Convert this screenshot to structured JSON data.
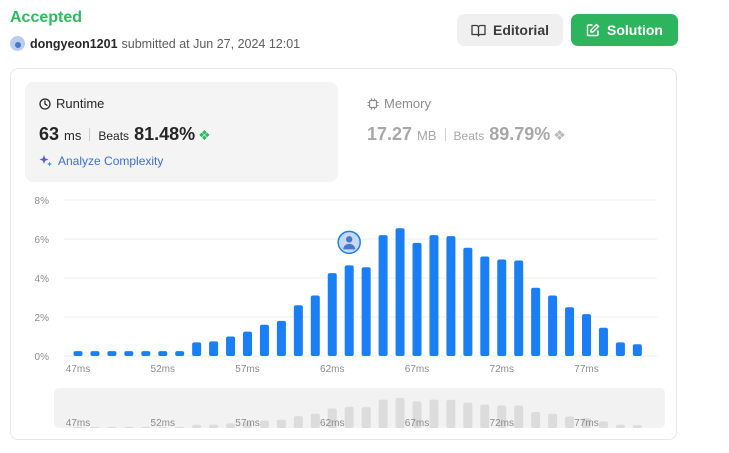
{
  "header": {
    "status": "Accepted",
    "username": "dongyeon1201",
    "submitted_text": "submitted at Jun 27, 2024 12:01"
  },
  "buttons": {
    "editorial": "Editorial",
    "solution": "Solution"
  },
  "runtime": {
    "label": "Runtime",
    "value": "63",
    "unit": "ms",
    "beats_label": "Beats",
    "beats_pct": "81.48%",
    "analyze_label": "Analyze Complexity"
  },
  "memory": {
    "label": "Memory",
    "value": "17.27",
    "unit": "MB",
    "beats_label": "Beats",
    "beats_pct": "89.79%"
  },
  "colors": {
    "accepted": "#2cbb5d",
    "bar": "#1a7ef5",
    "solution_button": "#2db55d",
    "overview_bar": "#dcdcdc"
  },
  "chart_data": {
    "type": "bar",
    "ylabel": "",
    "xlabel": "",
    "ylim": [
      0,
      8
    ],
    "yticks": [
      "0%",
      "2%",
      "4%",
      "6%",
      "8%"
    ],
    "xtick_labels": [
      "47ms",
      "52ms",
      "57ms",
      "62ms",
      "67ms",
      "72ms",
      "77ms"
    ],
    "x": [
      47,
      48,
      49,
      50,
      51,
      52,
      53,
      54,
      55,
      56,
      57,
      58,
      59,
      60,
      61,
      62,
      63,
      64,
      65,
      66,
      67,
      68,
      69,
      70,
      71,
      72,
      73,
      74,
      75,
      76,
      77,
      78,
      79,
      80
    ],
    "values": [
      0.25,
      0.25,
      0.25,
      0.25,
      0.25,
      0.25,
      0.25,
      0.7,
      0.75,
      1.0,
      1.25,
      1.6,
      1.8,
      2.6,
      3.1,
      4.25,
      4.65,
      4.55,
      6.2,
      6.55,
      5.8,
      6.2,
      6.15,
      5.55,
      5.1,
      4.95,
      4.9,
      3.5,
      3.1,
      2.5,
      2.15,
      1.45,
      0.7,
      0.6
    ],
    "highlight_x": 63,
    "grid": true
  }
}
